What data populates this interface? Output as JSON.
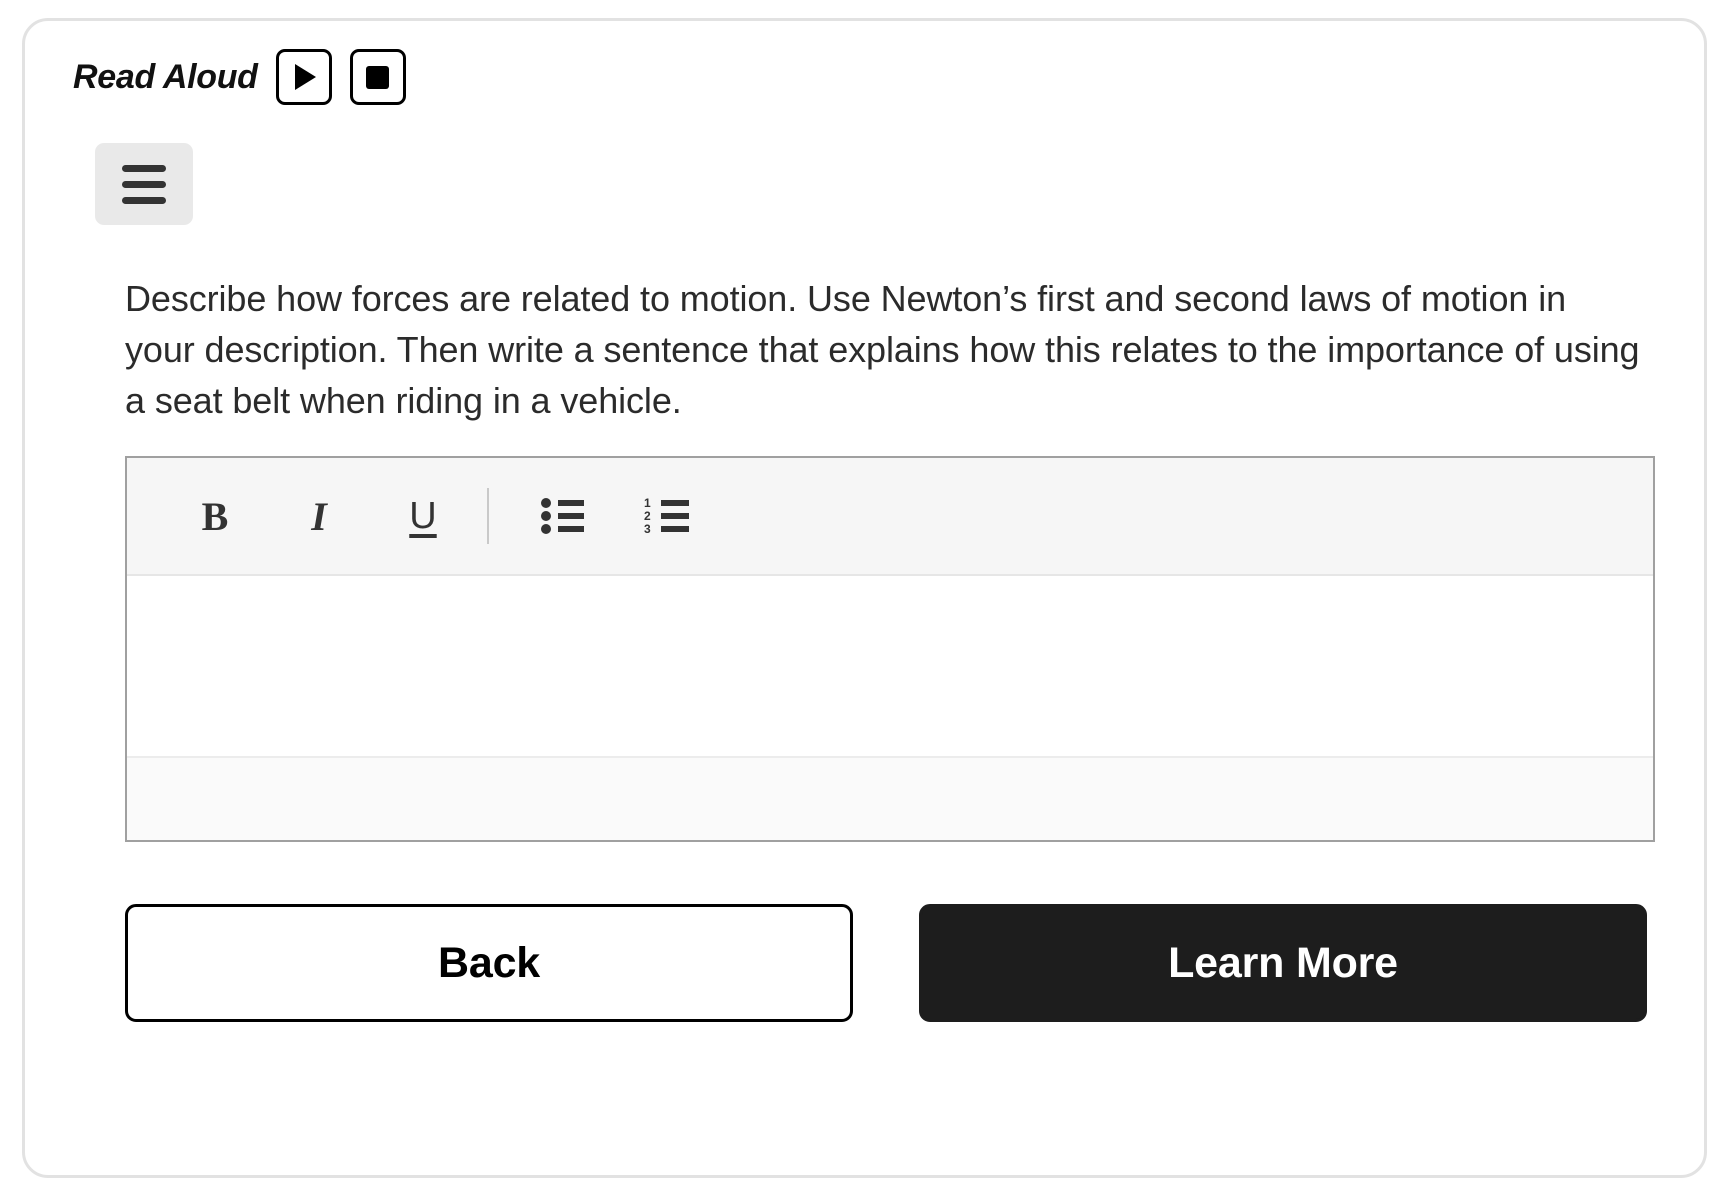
{
  "read_aloud": {
    "label": "Read Aloud",
    "play_icon": "play-icon",
    "stop_icon": "stop-icon"
  },
  "menu": {
    "icon": "hamburger-menu-icon"
  },
  "question": {
    "prompt": "Describe how forces are related to motion. Use Newton’s first and second laws of motion in your description. Then write a sentence that explains how this relates to the importance of using a seat belt when riding in a vehicle."
  },
  "editor": {
    "toolbar": {
      "bold_label": "B",
      "italic_label": "I",
      "underline_label": "U",
      "bullet_list_icon": "bulleted-list-icon",
      "numbered_list_icon": "numbered-list-icon",
      "numbered_list_digits": [
        "1",
        "2",
        "3"
      ]
    },
    "content": "",
    "placeholder": ""
  },
  "actions": {
    "back_label": "Back",
    "primary_label": "Learn More"
  },
  "colors": {
    "card_border": "#e2e2e2",
    "primary_button_bg": "#1d1d1d",
    "primary_button_text": "#ffffff",
    "menu_button_bg": "#e9e9e9",
    "toolbar_bg": "#f6f6f6",
    "editor_border": "#a0a0a0",
    "text": "#2b2b2b"
  }
}
